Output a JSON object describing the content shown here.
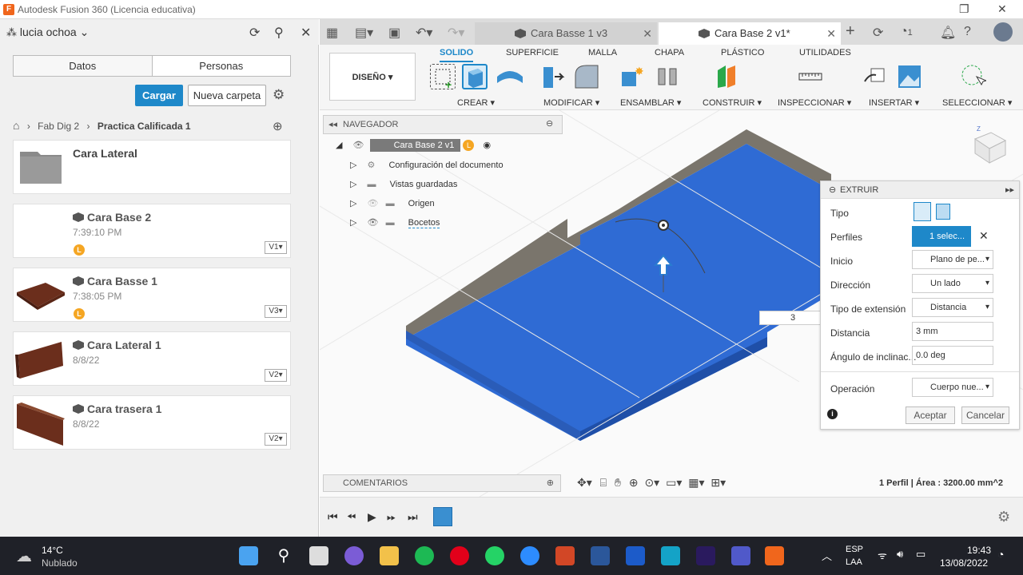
{
  "window": {
    "title": "Autodesk Fusion 360 (Licencia educativa)"
  },
  "left_panel": {
    "user": "lucia ochoa",
    "tabs": [
      "Datos",
      "Personas"
    ],
    "upload_label": "Cargar",
    "new_folder_label": "Nueva carpeta",
    "breadcrumb": [
      "Fab Dig 2",
      "Practica Calificada 1"
    ],
    "items": [
      {
        "title": "Cara Lateral",
        "subtitle": "",
        "version": ""
      },
      {
        "title": "Cara Base 2",
        "subtitle": "7:39:10 PM",
        "version": "V1▾",
        "badge": "L"
      },
      {
        "title": "Cara Basse 1",
        "subtitle": "7:38:05 PM",
        "version": "V3▾",
        "badge": "L"
      },
      {
        "title": "Cara Lateral 1",
        "subtitle": "8/8/22",
        "version": "V2▾"
      },
      {
        "title": "Cara trasera 1",
        "subtitle": "8/8/22",
        "version": "V2▾"
      }
    ]
  },
  "tabs": [
    {
      "label": "Cara Basse 1 v3"
    },
    {
      "label": "Cara Base 2 v1*"
    }
  ],
  "header_counter": "1",
  "toolbar": {
    "workspace": "DISEÑO ▾",
    "tabs": [
      "SOLIDO",
      "SUPERFICIE",
      "MALLA",
      "CHAPA",
      "PLÁSTICO",
      "UTILIDADES"
    ],
    "groups": [
      "CREAR ▾",
      "MODIFICAR ▾",
      "ENSAMBLAR ▾",
      "CONSTRUIR ▾",
      "INSPECCIONAR ▾",
      "INSERTAR ▾",
      "SELECCIONAR ▾"
    ]
  },
  "navigator": {
    "title": "NAVEGADOR",
    "root": "Cara Base 2 v1",
    "items": [
      "Configuración del documento",
      "Vistas guardadas",
      "Origen",
      "Bocetos"
    ]
  },
  "extrude": {
    "title": "EXTRUIR",
    "rows": [
      {
        "label": "Tipo",
        "value": ""
      },
      {
        "label": "Perfiles",
        "value": "1 selec..."
      },
      {
        "label": "Inicio",
        "value": "Plano de pe..."
      },
      {
        "label": "Dirección",
        "value": "Un lado"
      },
      {
        "label": "Tipo de extensión",
        "value": "Distancia"
      },
      {
        "label": "Distancia",
        "value": "3 mm"
      },
      {
        "label": "Ángulo de inclinac...",
        "value": "0.0 deg"
      },
      {
        "label": "Operación",
        "value": "Cuerpo nue..."
      }
    ],
    "ok": "Aceptar",
    "cancel": "Cancelar",
    "input_value": "3"
  },
  "comments": "COMENTARIOS",
  "status": "1 Perfil | Área : 3200.00 mm^2",
  "taskbar": {
    "weather_temp": "14°C",
    "weather_text": "Nublado",
    "lang1": "ESP",
    "lang2": "LAA",
    "time": "19:43",
    "date": "13/08/2022"
  }
}
